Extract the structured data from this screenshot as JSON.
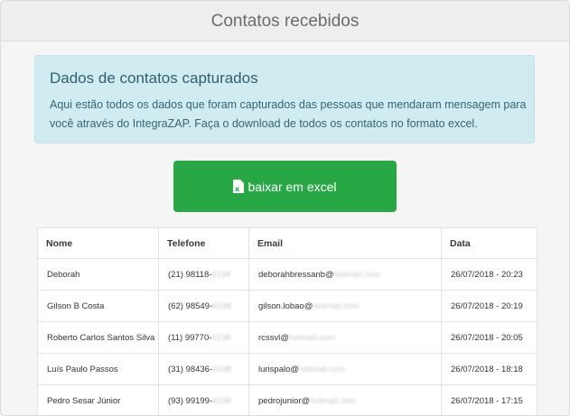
{
  "header": {
    "title": "Contatos recebidos"
  },
  "alert": {
    "title": "Dados de contatos capturados",
    "text": "Aqui estão todos os dados que foram capturados das pessoas que mendaram mensagem para você através do IntegraZAP. Faça o download de todos os contatos no formato excel."
  },
  "download": {
    "label": "baixar em excel",
    "icon": "excel-file-icon"
  },
  "table": {
    "headers": [
      "Nome",
      "Telefone",
      "Email",
      "Data"
    ],
    "rows": [
      {
        "nome": "Deborah",
        "tel": "(21) 98118-",
        "tel_hidden": "6198",
        "email": "deborahbressanb@",
        "email_hidden": "hotmail.com",
        "data": "26/07/2018 - 20:23"
      },
      {
        "nome": "Gilson B Costa",
        "tel": "(62) 98549-",
        "tel_hidden": "6198",
        "email": "gilson.lobao@",
        "email_hidden": "hotmail.com",
        "data": "26/07/2018 - 20:19"
      },
      {
        "nome": "Roberto Carlos Santos Silva",
        "tel": "(11) 99770-",
        "tel_hidden": "6198",
        "email": "rcssvl@",
        "email_hidden": "hotmail.com",
        "data": "26/07/2018 - 20:05"
      },
      {
        "nome": "Luís Paulo Passos",
        "tel": "(31) 98436-",
        "tel_hidden": "6198",
        "email": "lurispalo@",
        "email_hidden": "hotmail.com",
        "data": "26/07/2018 - 18:18"
      },
      {
        "nome": "Pedro Sesar Júnior",
        "tel": "(93) 99199-",
        "tel_hidden": "6198",
        "email": "pedrojunior@",
        "email_hidden": "hotmail.com",
        "data": "26/07/2018 - 17:15"
      }
    ]
  }
}
